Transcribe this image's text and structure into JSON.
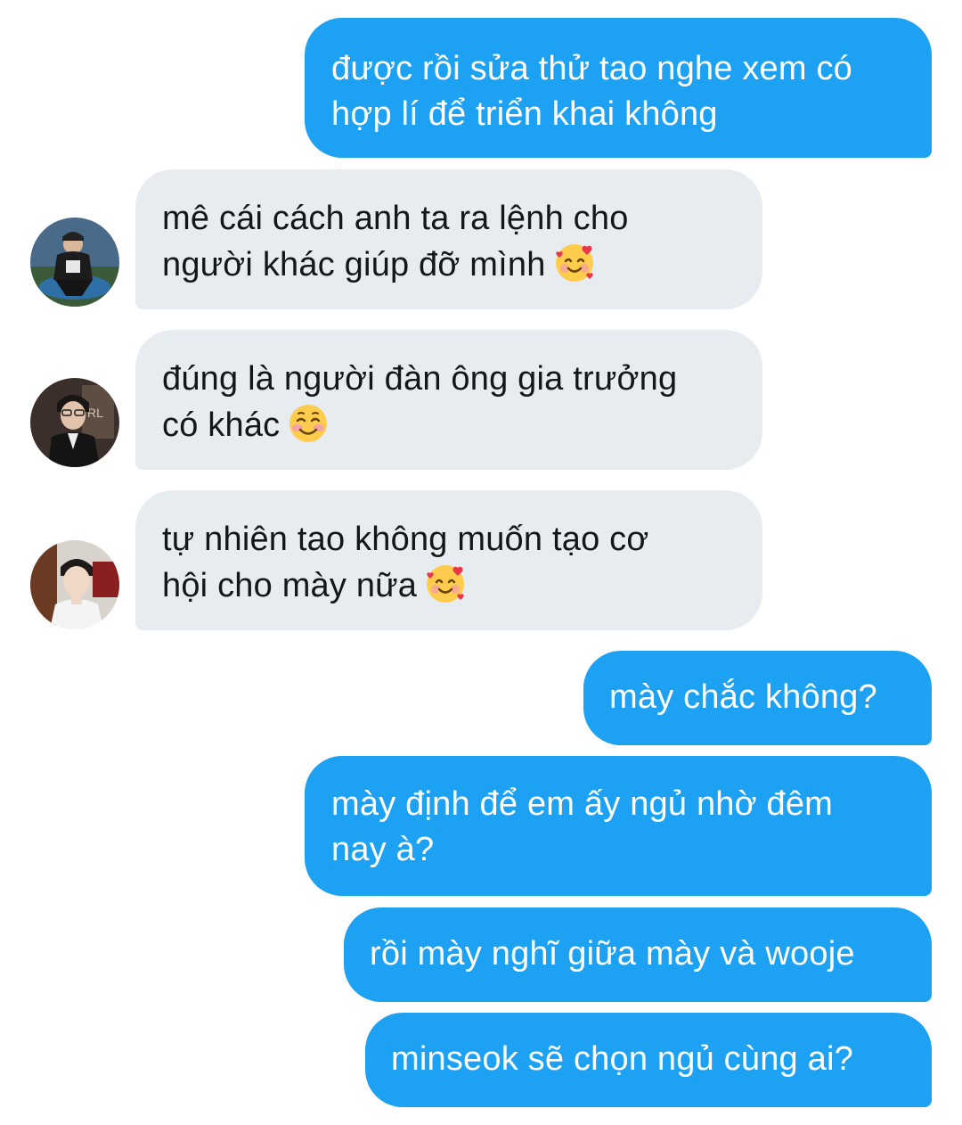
{
  "colors": {
    "outgoing_bubble": "#1da1f2",
    "incoming_bubble": "#e6ecf0",
    "outgoing_text": "#ffffff",
    "incoming_text": "#14171a"
  },
  "messages": [
    {
      "direction": "outgoing",
      "lines": [
        "được rồi sửa thử tao nghe xem có",
        "hợp lí để triển khai không"
      ]
    },
    {
      "direction": "incoming",
      "avatar": "avatar-1",
      "lines": [
        "mê cái cách anh ta ra lệnh cho",
        "người khác giúp đỡ mình"
      ],
      "emoji": "smiling-face-with-hearts"
    },
    {
      "direction": "incoming",
      "avatar": "avatar-2",
      "lines": [
        "đúng là người đàn ông gia trưởng",
        "có khác"
      ],
      "emoji": "smiling-face-blush"
    },
    {
      "direction": "incoming",
      "avatar": "avatar-3",
      "lines": [
        "tự nhiên tao không muốn tạo cơ",
        "hội cho mày nữa"
      ],
      "emoji": "smiling-face-with-hearts"
    },
    {
      "direction": "outgoing",
      "lines": [
        "mày chắc không?"
      ]
    },
    {
      "direction": "outgoing",
      "lines": [
        "mày định để em ấy ngủ nhờ đêm",
        "nay à?"
      ]
    },
    {
      "direction": "outgoing",
      "lines": [
        "rồi mày nghĩ giữa mày và wooje"
      ]
    },
    {
      "direction": "outgoing",
      "lines": [
        "minseok sẽ chọn ngủ cùng ai?"
      ]
    }
  ]
}
